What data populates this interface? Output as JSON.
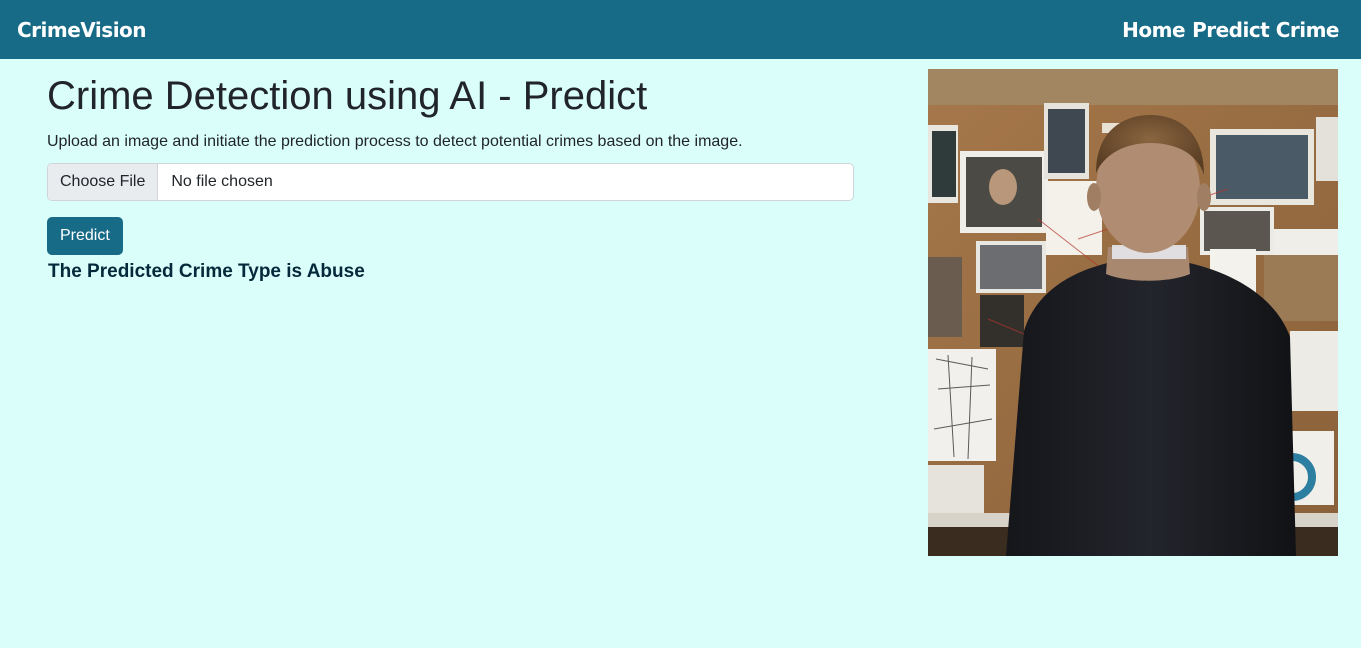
{
  "navbar": {
    "brand": "CrimeVision",
    "links": [
      {
        "label": "Home"
      },
      {
        "label": "Predict Crime"
      }
    ]
  },
  "main": {
    "title": "Crime Detection using AI - Predict",
    "description": "Upload an image and initiate the prediction process to detect potential crimes based on the image.",
    "file_input": {
      "button_label": "Choose File",
      "status": "No file chosen"
    },
    "predict_label": "Predict",
    "result": "The Predicted Crime Type is Abuse"
  },
  "image": {
    "description_icon": "detective-photo",
    "alt": ""
  },
  "colors": {
    "navbar": "#176b87",
    "background": "#dafffb",
    "button": "#176b87",
    "result_text": "#04293a"
  }
}
